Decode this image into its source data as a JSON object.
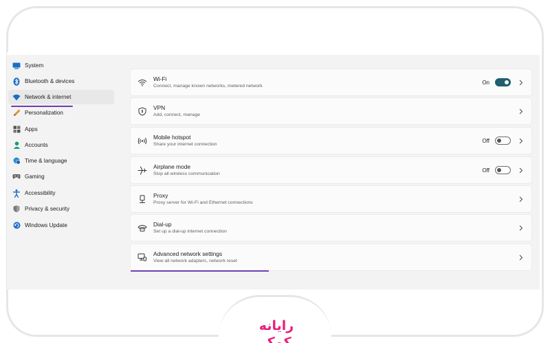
{
  "sidebar": {
    "items": [
      {
        "label": "System",
        "icon": "monitor-icon",
        "active": false
      },
      {
        "label": "Bluetooth & devices",
        "icon": "bluetooth-icon",
        "active": false
      },
      {
        "label": "Network & internet",
        "icon": "wifi-diamond-icon",
        "active": true
      },
      {
        "label": "Personalization",
        "icon": "pencil-icon",
        "active": false
      },
      {
        "label": "Apps",
        "icon": "apps-grid-icon",
        "active": false
      },
      {
        "label": "Accounts",
        "icon": "person-icon",
        "active": false
      },
      {
        "label": "Time & language",
        "icon": "globe-clock-icon",
        "active": false
      },
      {
        "label": "Gaming",
        "icon": "gamepad-icon",
        "active": false
      },
      {
        "label": "Accessibility",
        "icon": "accessibility-icon",
        "active": false
      },
      {
        "label": "Privacy & security",
        "icon": "shield-icon",
        "active": false
      },
      {
        "label": "Windows Update",
        "icon": "update-icon",
        "active": false
      }
    ]
  },
  "network": {
    "cards": [
      {
        "title": "Wi-Fi",
        "desc": "Connect, manage known networks, metered network",
        "icon": "wifi-icon",
        "toggle_label": "On",
        "toggle_state": "on"
      },
      {
        "title": "VPN",
        "desc": "Add, connect, manage",
        "icon": "vpn-shield-icon"
      },
      {
        "title": "Mobile hotspot",
        "desc": "Share your internet connection",
        "icon": "hotspot-icon",
        "toggle_label": "Off",
        "toggle_state": "off"
      },
      {
        "title": "Airplane mode",
        "desc": "Stop all wireless communication",
        "icon": "airplane-icon",
        "toggle_label": "Off",
        "toggle_state": "off"
      },
      {
        "title": "Proxy",
        "desc": "Proxy server for Wi-Fi and Ethernet connections",
        "icon": "proxy-icon"
      },
      {
        "title": "Dial-up",
        "desc": "Set up a dial-up internet connection",
        "icon": "dialup-icon"
      },
      {
        "title": "Advanced network settings",
        "desc": "View all network adapters, network reset",
        "icon": "network-pc-icon"
      }
    ]
  },
  "colors": {
    "accent": "#1f5f6e",
    "highlight": "#6d3fb3",
    "brand": "#ea1e7c"
  },
  "watermark": {
    "text": "رایانه کمک"
  }
}
